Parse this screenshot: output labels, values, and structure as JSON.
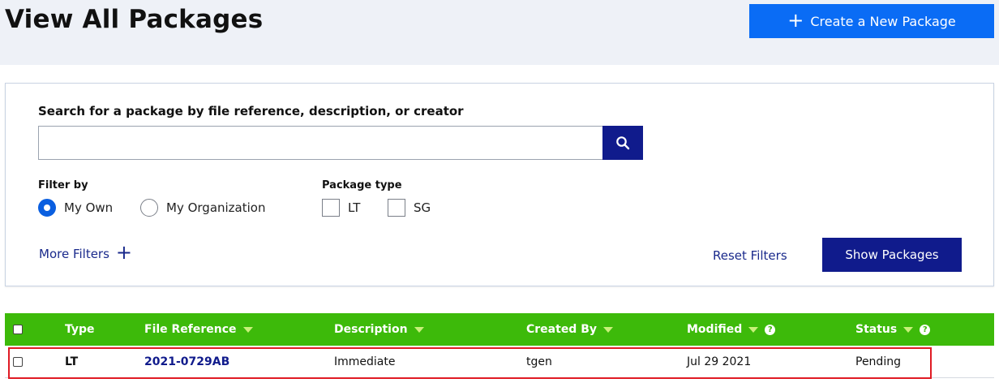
{
  "header": {
    "title": "View All Packages",
    "create_button_label": "Create a New Package"
  },
  "search": {
    "label": "Search for a package by file reference, description, or creator",
    "value": "",
    "placeholder": ""
  },
  "filters": {
    "filter_by_label": "Filter by",
    "filter_by_options": [
      {
        "label": "My Own",
        "selected": true
      },
      {
        "label": "My Organization",
        "selected": false
      }
    ],
    "package_type_label": "Package type",
    "package_type_options": [
      {
        "label": "LT",
        "checked": false
      },
      {
        "label": "SG",
        "checked": false
      }
    ],
    "more_filters_label": "More Filters",
    "reset_label": "Reset Filters",
    "show_button_label": "Show Packages"
  },
  "table": {
    "columns": [
      "Type",
      "File Reference",
      "Description",
      "Created By",
      "Modified",
      "Status"
    ],
    "rows": [
      {
        "type": "LT",
        "file_reference": "2021-0729AB",
        "description": "Immediate",
        "created_by": "tgen",
        "modified": "Jul 29 2021",
        "status": "Pending"
      }
    ]
  },
  "colors": {
    "header_band": "#eef1f7",
    "primary_blue": "#0a6cf5",
    "navy": "#101b8c",
    "table_header_green": "#3dba0a",
    "highlight_red": "#e01b24"
  }
}
